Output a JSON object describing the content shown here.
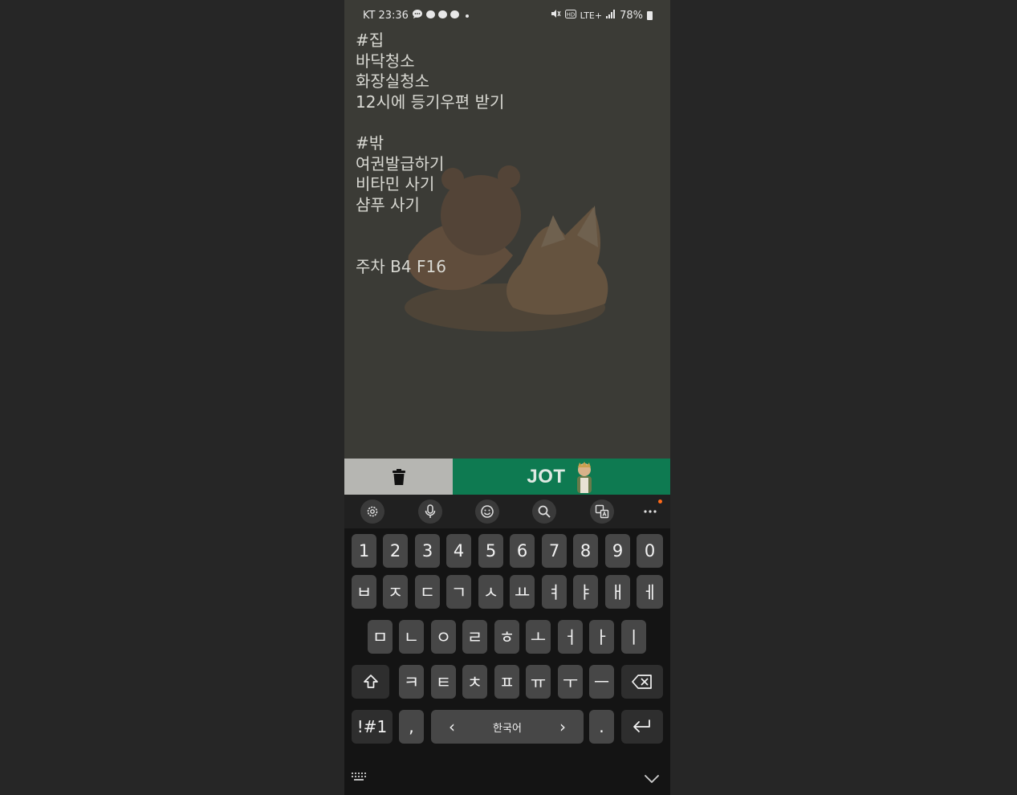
{
  "status_bar": {
    "carrier": "KT",
    "time": "23:36",
    "network": "LTE+",
    "battery": "78%"
  },
  "note": {
    "lines": [
      "#집",
      "바닥청소",
      "화장실청소",
      "12시에 등기우편 받기",
      "",
      "#밖",
      "여권발급하기",
      "비타민 사기",
      "샴푸 사기",
      "",
      "",
      "주차 B4 F16"
    ]
  },
  "action_bar": {
    "jot_label": "JOT"
  },
  "keyboard": {
    "row_numbers": [
      "1",
      "2",
      "3",
      "4",
      "5",
      "6",
      "7",
      "8",
      "9",
      "0"
    ],
    "row1": [
      "ㅂ",
      "ㅈ",
      "ㄷ",
      "ㄱ",
      "ㅅ",
      "ㅛ",
      "ㅕ",
      "ㅑ",
      "ㅐ",
      "ㅔ"
    ],
    "row2": [
      "ㅁ",
      "ㄴ",
      "ㅇ",
      "ㄹ",
      "ㅎ",
      "ㅗ",
      "ㅓ",
      "ㅏ",
      "ㅣ"
    ],
    "row3": [
      "ㅋ",
      "ㅌ",
      "ㅊ",
      "ㅍ",
      "ㅠ",
      "ㅜ",
      "ㅡ"
    ],
    "symbols_label": "!#1",
    "comma": ",",
    "space_label": "한국어",
    "space_left": "‹",
    "space_right": "›",
    "period": "."
  },
  "colors": {
    "note_bg": "#3b3b36",
    "jot_green": "#0e7a51",
    "trash_gray": "#b6b6b2",
    "keyboard_bg": "#141414",
    "key_bg": "#474747",
    "notification_dot": "#ff6a1a"
  }
}
